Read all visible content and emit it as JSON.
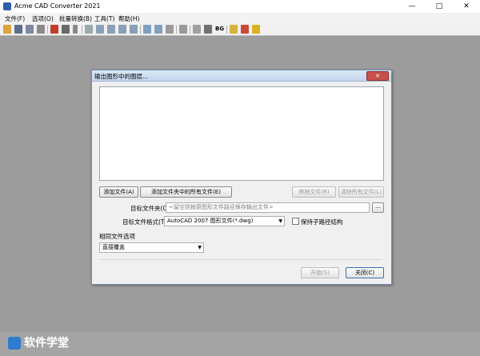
{
  "window": {
    "title": "Acme CAD Converter 2021",
    "min": "—",
    "max": "□",
    "close": "✕"
  },
  "menu": [
    "文件(F)",
    "选项(O)",
    "批量转换(B)",
    "工具(T)",
    "帮助(H)"
  ],
  "toolbar": {
    "bg_label": "BG"
  },
  "dialog": {
    "title": "输出图形中的图层...",
    "close_label": "✕",
    "buttons": {
      "add_file": "添加文件(A)",
      "add_folder_files": "添加文件夹中的所有文件(E)",
      "remove_file": "移除文件(R)",
      "clear_all": "清除所有文件(L)",
      "browse": "...",
      "start": "开始(S)",
      "close": "关闭(C)"
    },
    "target_folder": {
      "label": "目标文件夹(Q)",
      "placeholder": "<留空则按原图形文件路径保存输出文件>"
    },
    "target_format": {
      "label": "目标文件格式(T)",
      "value": "AutoCAD 2007 图形文件(*.dwg)"
    },
    "keep_subdir": {
      "label": "保持子路径结构",
      "checked": false
    },
    "same_file": {
      "label": "相同文件选项",
      "value": "直接覆盖"
    }
  },
  "watermark": {
    "text": "软件学堂"
  },
  "colors": {
    "accent": "#3d6fb6",
    "workspace": "#9c9c9c",
    "title_bar": "#ffffff"
  }
}
